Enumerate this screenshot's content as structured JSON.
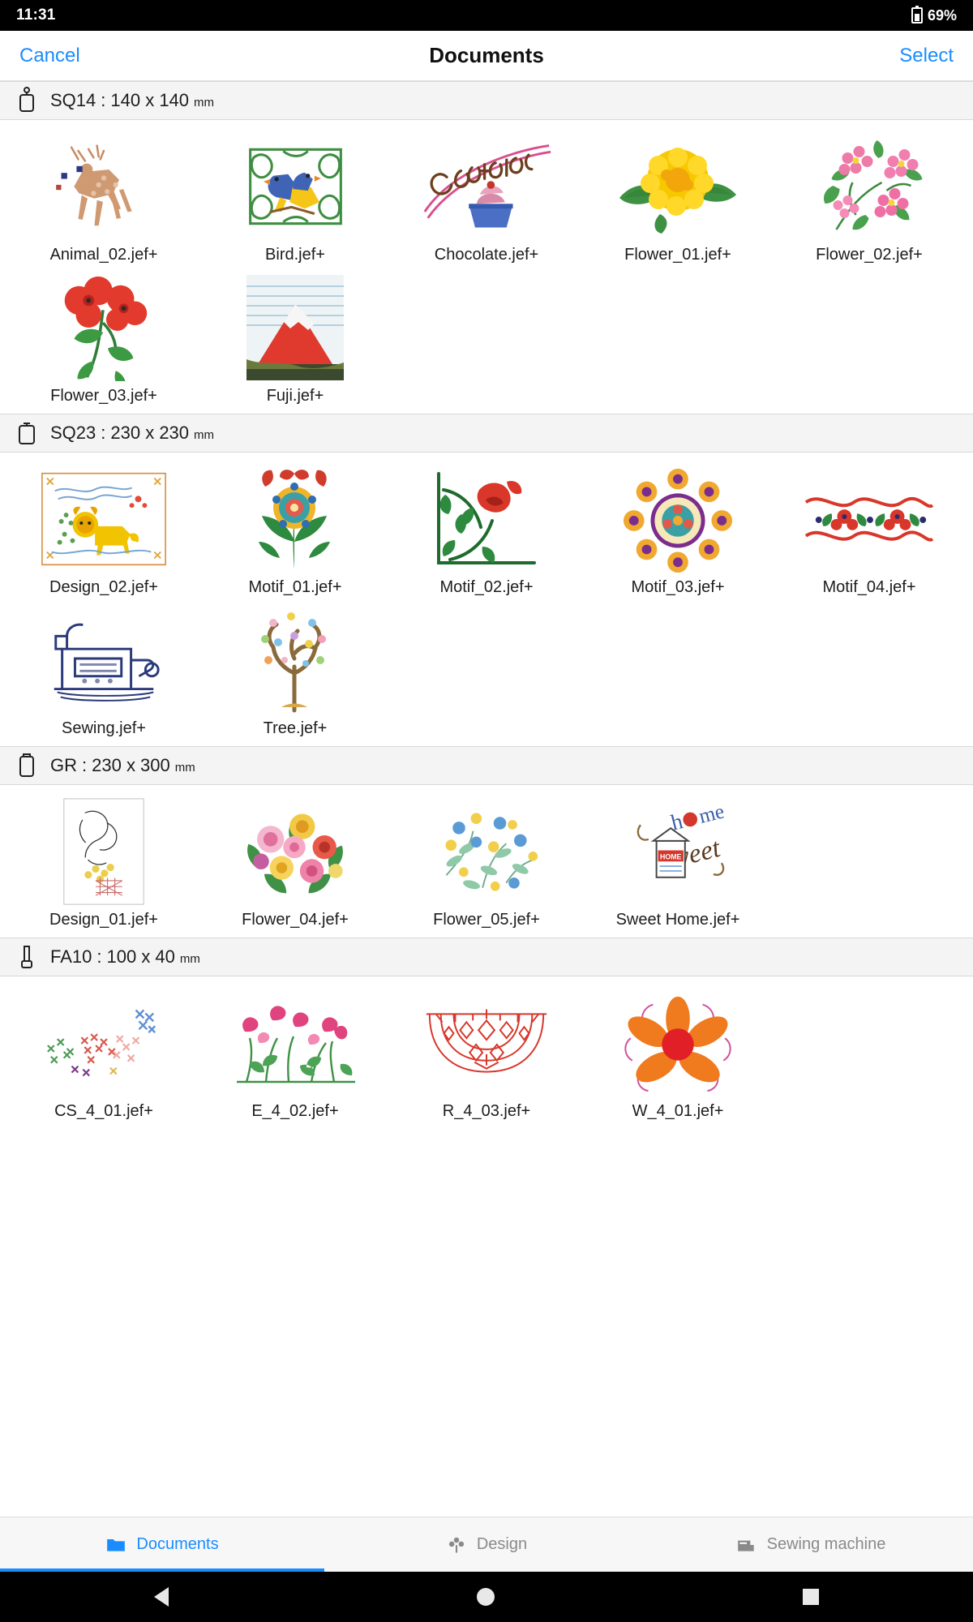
{
  "status_bar": {
    "clock": "11:31",
    "battery_pct": "69%",
    "battery_icon": "battery-charging-icon"
  },
  "navbar": {
    "cancel_label": "Cancel",
    "title": "Documents",
    "select_label": "Select"
  },
  "sections": [
    {
      "id": "sq14",
      "icon": "hoop-sq14-icon",
      "name": "SQ14",
      "size": "140 x 140",
      "unit": "mm",
      "items": [
        {
          "label": "Animal_02.jef+",
          "art": "deer"
        },
        {
          "label": "Bird.jef+",
          "art": "birds"
        },
        {
          "label": "Chocolate.jef+",
          "art": "chocolate"
        },
        {
          "label": "Flower_01.jef+",
          "art": "marigold"
        },
        {
          "label": "Flower_02.jef+",
          "art": "pinkblossom"
        },
        {
          "label": "Flower_03.jef+",
          "art": "poppy"
        },
        {
          "label": "Fuji.jef+",
          "art": "fuji"
        }
      ]
    },
    {
      "id": "sq23",
      "icon": "hoop-sq23-icon",
      "name": "SQ23",
      "size": "230 x 230",
      "unit": "mm",
      "items": [
        {
          "label": "Design_02.jef+",
          "art": "lion"
        },
        {
          "label": "Motif_01.jef+",
          "art": "motif1"
        },
        {
          "label": "Motif_02.jef+",
          "art": "motif2"
        },
        {
          "label": "Motif_03.jef+",
          "art": "motif3"
        },
        {
          "label": "Motif_04.jef+",
          "art": "motif4"
        },
        {
          "label": "Sewing.jef+",
          "art": "sewing"
        },
        {
          "label": "Tree.jef+",
          "art": "tree"
        }
      ]
    },
    {
      "id": "gr",
      "icon": "hoop-gr-icon",
      "name": "GR",
      "size": "230 x 300",
      "unit": "mm",
      "items": [
        {
          "label": "Design_01.jef+",
          "art": "sketch"
        },
        {
          "label": "Flower_04.jef+",
          "art": "bouquet"
        },
        {
          "label": "Flower_05.jef+",
          "art": "scatter"
        },
        {
          "label": "Sweet Home.jef+",
          "art": "sweethome"
        }
      ]
    },
    {
      "id": "fa10",
      "icon": "hoop-fa10-icon",
      "name": "FA10",
      "size": "100 x 40",
      "unit": "mm",
      "items": [
        {
          "label": "CS_4_01.jef+",
          "art": "crossstitch"
        },
        {
          "label": "E_4_02.jef+",
          "art": "tulips"
        },
        {
          "label": "R_4_03.jef+",
          "art": "redlace"
        },
        {
          "label": "W_4_01.jef+",
          "art": "orangeflower"
        }
      ]
    }
  ],
  "tabbar": {
    "tabs": [
      {
        "label": "Documents",
        "icon": "folder-icon",
        "active": true
      },
      {
        "label": "Design",
        "icon": "flower-gear-icon",
        "active": false
      },
      {
        "label": "Sewing machine",
        "icon": "sewing-machine-icon",
        "active": false
      }
    ]
  },
  "android_nav": {
    "back": "back-triangle-icon",
    "home": "home-circle-icon",
    "recents": "recents-square-icon"
  },
  "colors": {
    "accent": "#1a8cff",
    "section_bg": "#f4f4f4",
    "tab_inactive": "#8a8a8a"
  }
}
